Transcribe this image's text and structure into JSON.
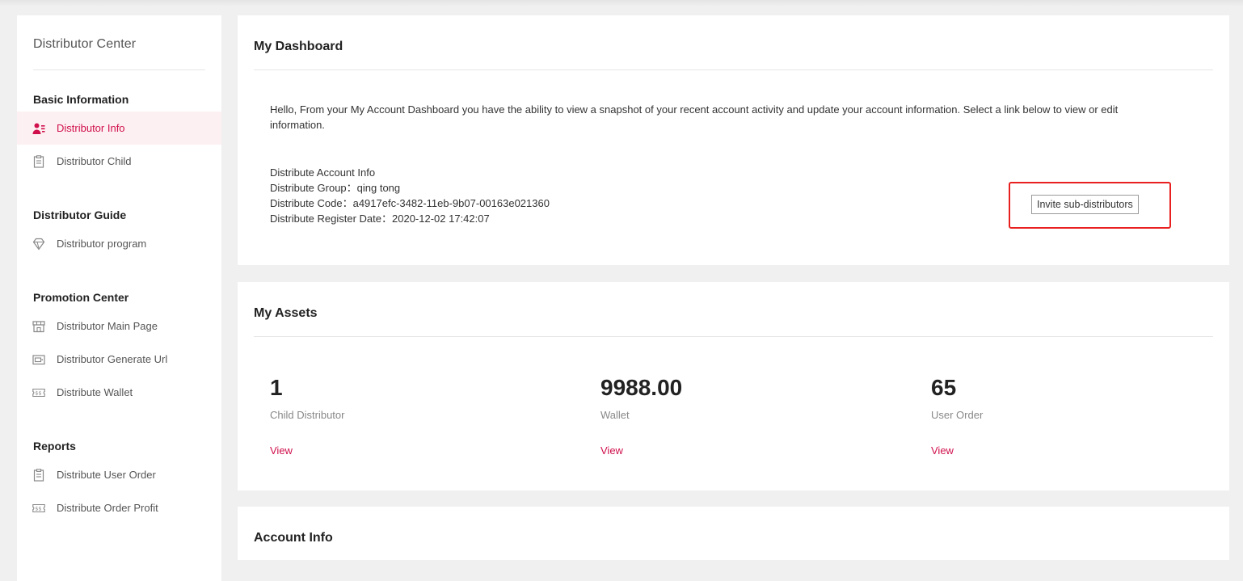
{
  "sidebar": {
    "title": "Distributor Center",
    "sections": [
      {
        "title": "Basic Information",
        "items": [
          {
            "label": "Distributor Info",
            "icon": "user-list-icon",
            "active": true
          },
          {
            "label": "Distributor Child",
            "icon": "clipboard-icon",
            "active": false
          }
        ]
      },
      {
        "title": "Distributor Guide",
        "items": [
          {
            "label": "Distributor program",
            "icon": "diamond-icon",
            "active": false
          }
        ]
      },
      {
        "title": "Promotion Center",
        "items": [
          {
            "label": "Distributor Main Page",
            "icon": "storefront-icon",
            "active": false
          },
          {
            "label": "Distributor Generate Url",
            "icon": "card-icon",
            "active": false
          },
          {
            "label": "Distribute Wallet",
            "icon": "ticket-icon",
            "active": false
          }
        ]
      },
      {
        "title": "Reports",
        "items": [
          {
            "label": "Distribute User Order",
            "icon": "clipboard-icon",
            "active": false
          },
          {
            "label": "Distribute Order Profit",
            "icon": "ticket-icon",
            "active": false
          }
        ]
      }
    ]
  },
  "dashboard": {
    "title": "My Dashboard",
    "intro": "Hello, From your My Account Dashboard you have the ability to view a snapshot of your recent account activity and update your account information. Select a link below to view or edit information.",
    "account_heading": "Distribute Account Info",
    "group_line": "Distribute Group：qing tong",
    "code_line": "Distribute Code：a4917efc-3482-11eb-9b07-00163e021360",
    "date_line": "Distribute Register Date：2020-12-02 17:42:07",
    "invite_button": "Invite sub-distributors"
  },
  "assets": {
    "title": "My Assets",
    "items": [
      {
        "value": "1",
        "label": "Child Distributor",
        "link": "View"
      },
      {
        "value": "9988.00",
        "label": "Wallet",
        "link": "View"
      },
      {
        "value": "65",
        "label": "User Order",
        "link": "View"
      }
    ]
  },
  "account_info": {
    "title": "Account Info"
  },
  "colors": {
    "accent": "#d0104c",
    "highlight": "#e8201f",
    "active_bg": "#fdf0f2"
  }
}
